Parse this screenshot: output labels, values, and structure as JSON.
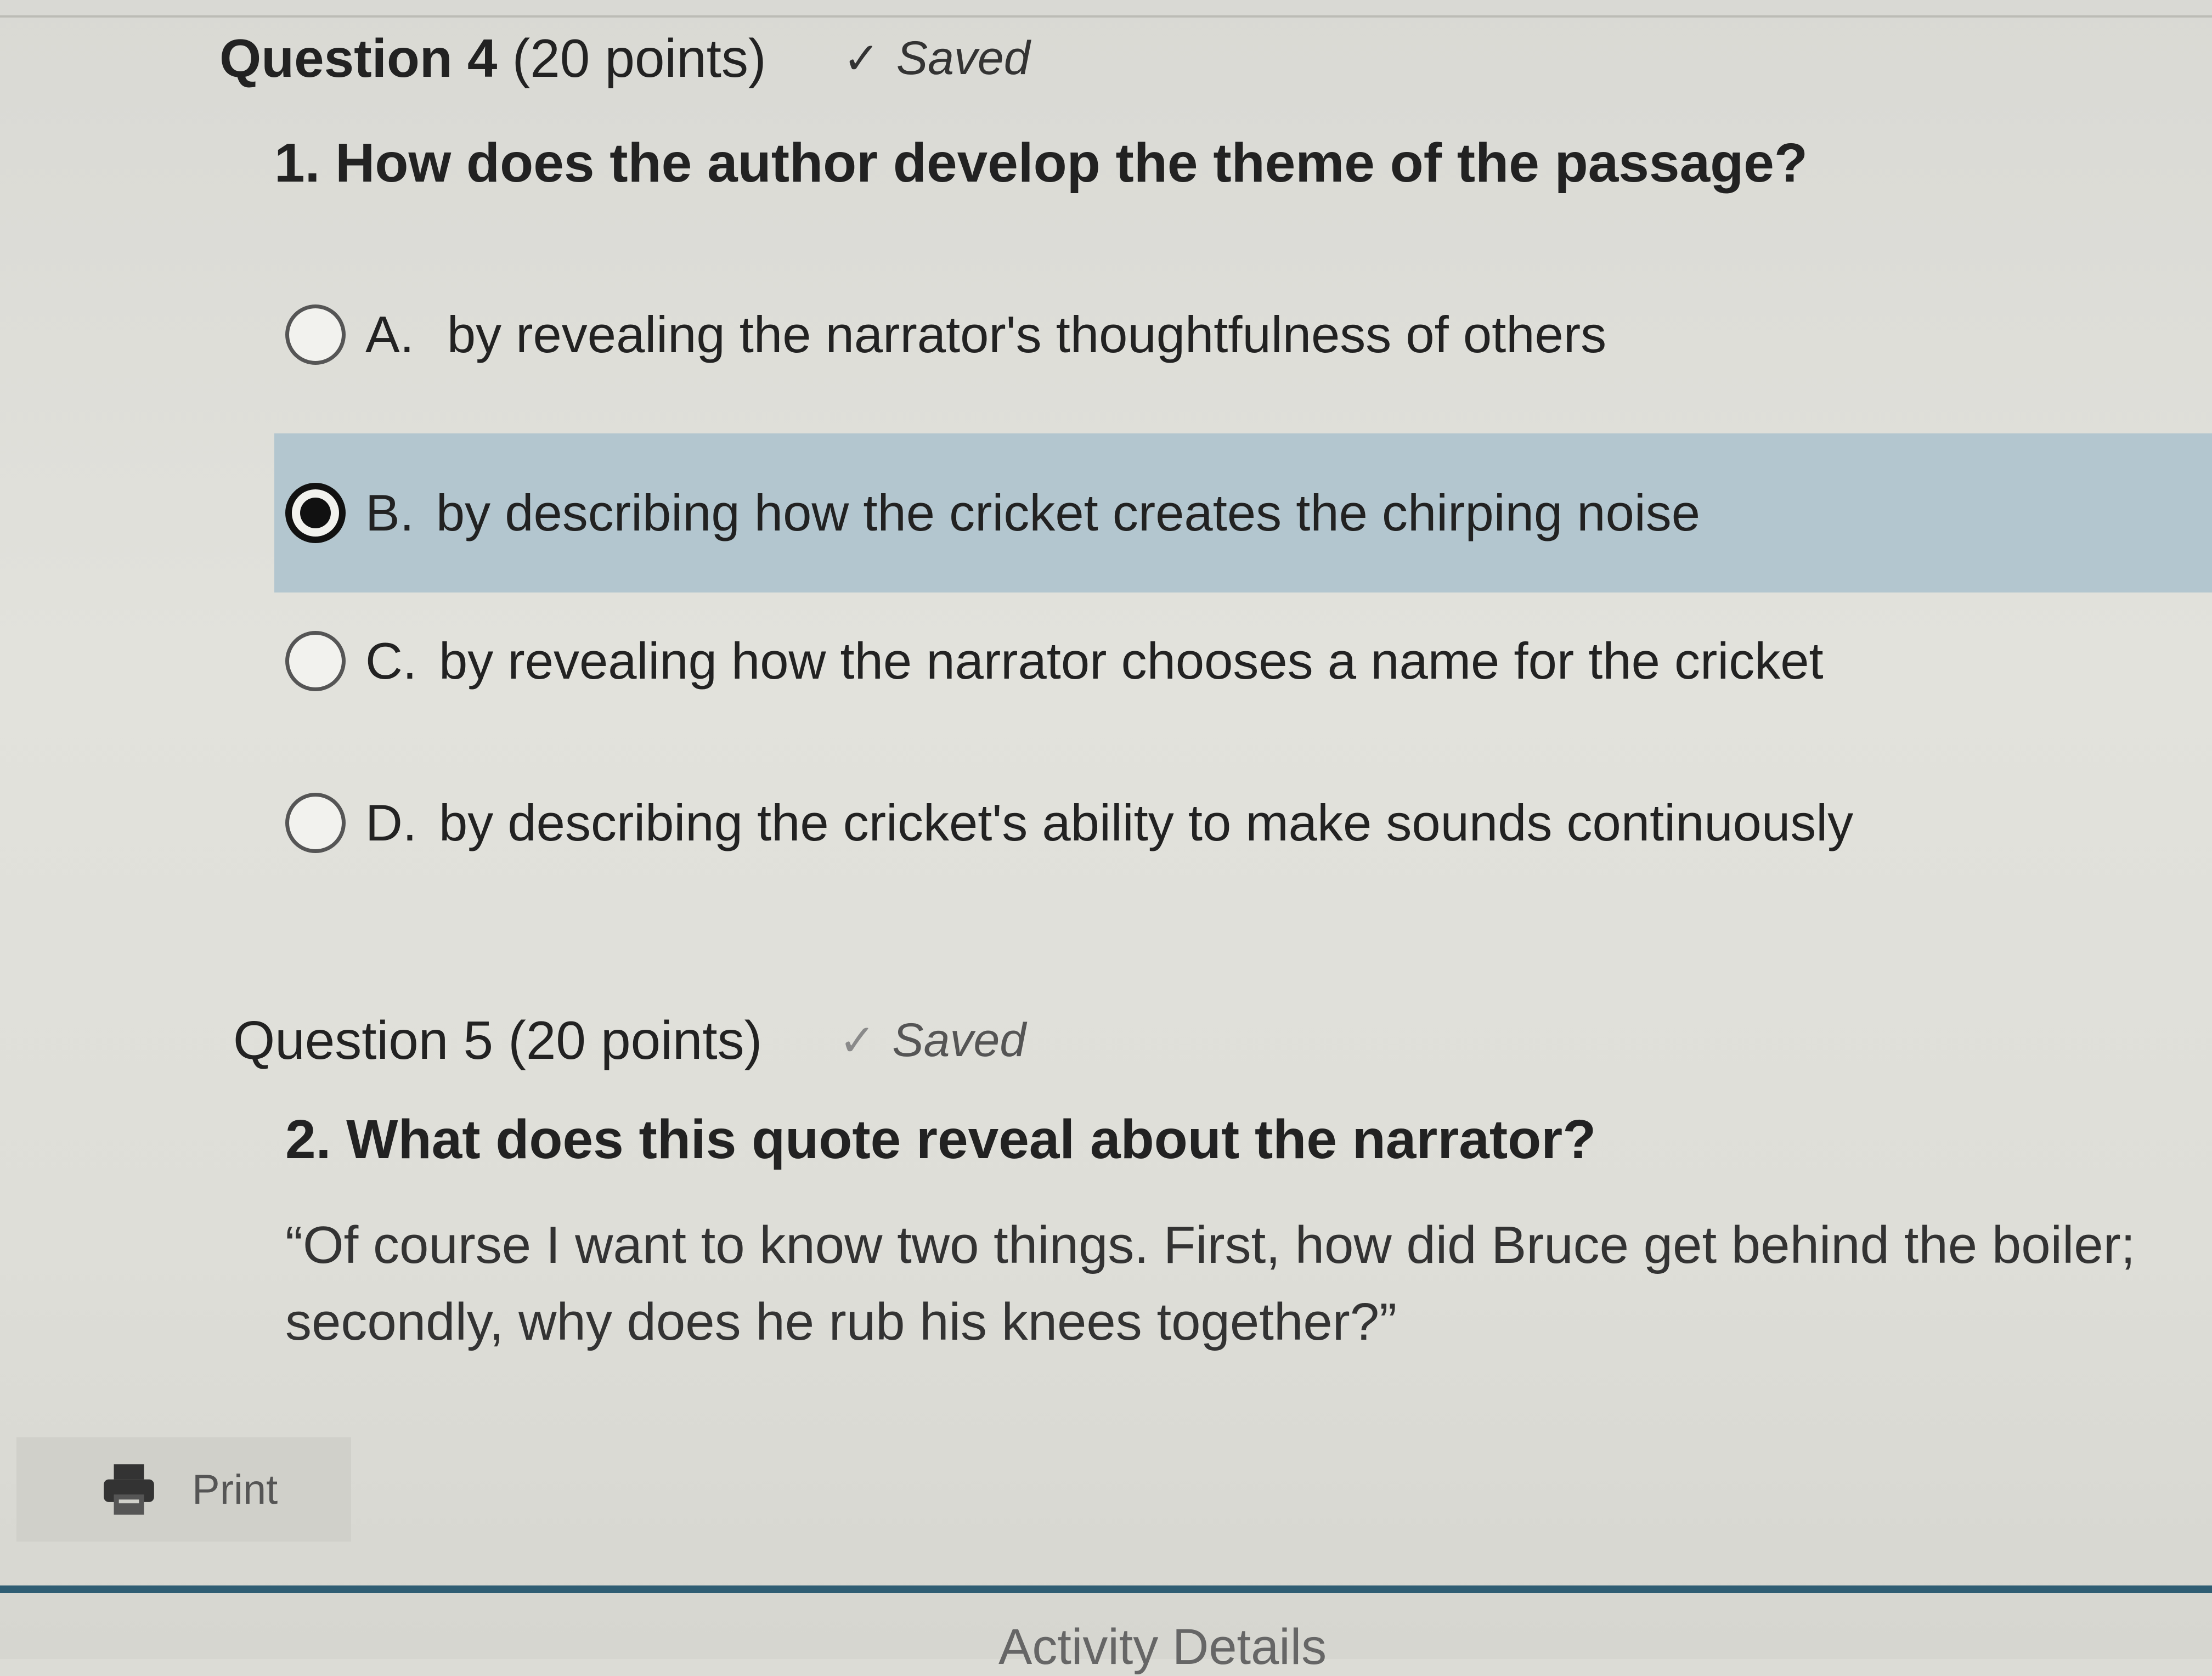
{
  "question4": {
    "name": "Question 4",
    "points": "(20 points)",
    "saved": "Saved",
    "text": "1. How does the author develop the theme of the passage?",
    "options": [
      {
        "letter": "A.",
        "text": "by revealing the narrator's thoughtfulness of others",
        "selected": false
      },
      {
        "letter": "B.",
        "text": "by describing how the cricket creates the chirping noise",
        "selected": true
      },
      {
        "letter": "C.",
        "text": "by revealing how the narrator chooses a name for the cricket",
        "selected": false
      },
      {
        "letter": "D.",
        "text": "by describing the cricket's ability to make sounds continuously",
        "selected": false
      }
    ]
  },
  "question5": {
    "name": "Question 5",
    "points": "(20 points)",
    "saved": "Saved",
    "text": "2. What does this quote reveal about the narrator?",
    "quote": "“Of course I want to know two things. First, how did Bruce get behind the boiler; secondly, why does he rub his knees together?”"
  },
  "footer": {
    "print_label": "Print",
    "activity_label": "Activity Details"
  },
  "colors": {
    "selected_row": "#b3c6cf",
    "rule": "#2f5d73"
  },
  "icons": {
    "check": "check-icon",
    "print": "printer-icon",
    "radio": "radio-button"
  }
}
